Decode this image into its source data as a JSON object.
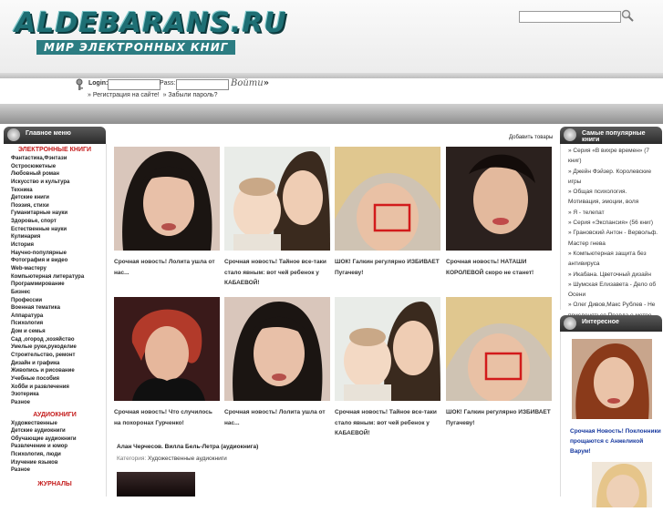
{
  "header": {
    "logo_title": "ALDEBARANS.RU",
    "logo_subtitle": "МИР ЭЛЕКТРОННЫХ КНИГ"
  },
  "login": {
    "login_label": "Login:",
    "pass_label": "Pass:",
    "enter_label": "Войти",
    "register_link": "» Регистрация на сайте!",
    "forgot_link": "» Забыли пароль?"
  },
  "left_menu": {
    "title": "Главное меню",
    "sections": [
      {
        "title": "ЭЛЕКТРОННЫЕ КНИГИ",
        "items": [
          "Фантастика,Фэнтази",
          "Остросюжетные",
          "Любовный роман",
          "Искусство и культура",
          "Техника",
          "Детские книги",
          "Поэзия, стихи",
          "Гуманитарные науки",
          "Здоровье, спорт",
          "Естественные науки",
          "Кулинария",
          "История",
          "Научно-популярные",
          "Фотография и видео",
          "Web-мастеру",
          "Компьютерная литература",
          "Программирование",
          "Бизнес",
          "Профессии",
          "Военная тематика",
          "Аппаратура",
          "Психология",
          "Дом и семья",
          "Сад ,огород ,хозяйство",
          "Умелые руки,рукоделие",
          "Строительство, ремонт",
          "Дизайн и графика",
          "Живопись и рисование",
          "Учебные пособия",
          "Хобби и развлечения",
          "Эзотерика",
          "Разное"
        ]
      },
      {
        "title": "АУДИОКНИГИ",
        "items": [
          "Художественные",
          "Детские аудиокниги",
          "Обучающие аудиокниги",
          "Развлечение и юмор",
          "Психология, люди",
          "Изучение языков",
          "Разное"
        ]
      },
      {
        "title": "ЖУРНАЛЫ",
        "items": []
      }
    ]
  },
  "main": {
    "add_goods_link": "Добавить товары",
    "tiles": [
      {
        "caption": "Срочная новость! Лолита ушла от нас..."
      },
      {
        "caption": "Срочная новость! Тайное все-таки стало явным: вот чей ребенок у КАБАЕВОЙ!"
      },
      {
        "caption": "ШОК! Галкин регулярно ИЗБИВАЕТ Пугачеву!"
      },
      {
        "caption": "Срочная новость! НАТАШИ КОРОЛЕВОЙ скоро не станет!"
      },
      {
        "caption": "Срочная новость! Что случилось на похоронах Гурченко!"
      },
      {
        "caption": "Срочная новость! Лолита ушла от нас..."
      },
      {
        "caption": "Срочная новость! Тайное все-таки стало явным: вот чей ребенок у КАБАЕВОЙ!"
      },
      {
        "caption": "ШОК! Галкин регулярно ИЗБИВАЕТ Пугачеву!"
      }
    ],
    "article_title": "Алан Черчесов. Вилла Бель-Летра (аудиокнига)",
    "category_label": "Категория:",
    "category_value": "Художественные аудиокниги"
  },
  "right": {
    "popular_title": "Самые популярные книги",
    "popular_items": [
      "» Серия «В вихре времен» (7 книг)",
      "» Джейн Фэйзер. Королевские игры",
      "» Общая психология. Мотивация, эмоции, воля",
      "» Я - телепат",
      "» Серия «Экспансия» (56 книг)",
      "» Грановский Антон - Вервольф. Мастер гнева",
      "» Компьютерная защита без антивируса",
      "» Икабана. Цветочный дизайн",
      "» Шумская Елизавета - Дело об Осени",
      "» Олег Дивов,Макс Рублев - Не прислоняться.Правда о метро"
    ],
    "interesting_title": "Интересное",
    "interesting_caption": "Срочная Новость! Поклонники прощаются с Анжеликой Варум!"
  },
  "colors": {
    "accent_red": "#c41b1b",
    "link_blue": "#15379e",
    "logo_teal": "#1e6f74"
  }
}
